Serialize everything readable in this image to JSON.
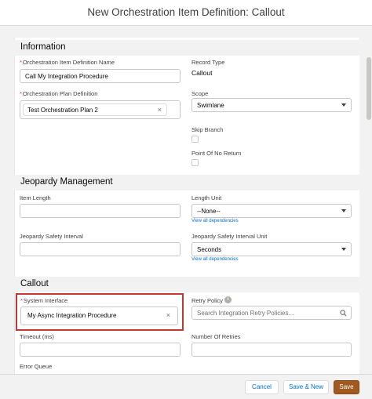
{
  "modal": {
    "title": "New Orchestration Item Definition: Callout"
  },
  "information": {
    "section_title": "Information",
    "name_label": "Orchestration Item Definition Name",
    "name_value": "Call My Integration Procedure",
    "record_type_label": "Record Type",
    "record_type_value": "Callout",
    "plan_label": "Orchestration Plan Definition",
    "plan_value": "Test Orchestration Plan 2",
    "scope_label": "Scope",
    "scope_value": "Swimlane",
    "skip_branch_label": "Skip Branch",
    "point_of_no_return_label": "Point Of No Return"
  },
  "jeopardy": {
    "section_title": "Jeopardy Management",
    "item_length_label": "Item Length",
    "item_length_value": "",
    "length_unit_label": "Length Unit",
    "length_unit_value": "--None--",
    "view_dependencies": "View all dependencies",
    "safety_interval_label": "Jeopardy Safety Interval",
    "safety_interval_value": "",
    "safety_interval_unit_label": "Jeopardy Safety Interval Unit",
    "safety_interval_unit_value": "Seconds"
  },
  "callout": {
    "section_title": "Callout",
    "system_interface_label": "System Interface",
    "system_interface_value": "My Async Integration Procedure",
    "retry_policy_label": "Retry Policy",
    "retry_policy_placeholder": "Search Integration Retry Policies...",
    "timeout_label": "Timeout (ms)",
    "number_of_retries_label": "Number Of Retries",
    "error_queue_label": "Error Queue"
  },
  "required_marker": "*",
  "clear_glyph": "×",
  "info_glyph": "i",
  "footer": {
    "cancel_label": "Cancel",
    "save_new_label": "Save & New",
    "save_label": "Save"
  },
  "colors": {
    "brand": "#0070d2",
    "highlight": "#c23934",
    "save_button": "#a05a1f"
  }
}
